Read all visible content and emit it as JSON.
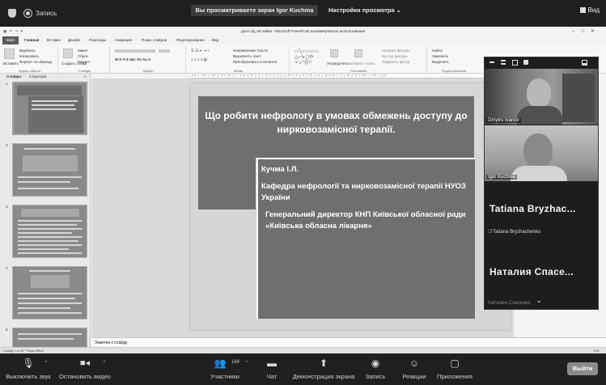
{
  "zoom_top": {
    "recording_label": "Запись",
    "share_banner": "Вы просматриваете экран Igor Kuchma",
    "view_options": "Настройки просмотра ⌄",
    "view_button": "Вид"
  },
  "ppt": {
    "window_title": "дало під час війни - Microsoft PowerPoint некоммерческое использование",
    "tabs": [
      "Файл",
      "Главная",
      "Вставка",
      "Дизайн",
      "Переходы",
      "Анимация",
      "Показ слайдов",
      "Рецензирование",
      "Вид"
    ],
    "ribbon": {
      "clipboard_label": "Буфер обмена",
      "paste": "Вставить",
      "cut": "Вырезать",
      "copy": "Копировать",
      "format_painter": "Формат по образцу",
      "slides_label": "Слайды",
      "new_slide": "Создать слайд",
      "layout": "Макет",
      "reset": "Сброс",
      "section": "Раздел",
      "font_label": "Шрифт",
      "paragraph_label": "Абзац",
      "text_direction": "Направление текста",
      "align_text": "Выровнять текст",
      "smartart": "Преобразовать в SmartArt",
      "drawing_label": "Рисование",
      "arrange": "Упорядочить",
      "quick_styles": "Экспресс-стили",
      "shape_fill": "Заливка фигуры",
      "shape_outline": "Контур фигуры",
      "shape_effects": "Эффекты фигур",
      "editing_label": "Редактирование",
      "find": "Найти",
      "replace": "Заменить",
      "select": "Выделить"
    },
    "pane_tabs": [
      "Слайды",
      "Структура"
    ],
    "thumb_numbers": [
      "1",
      "2",
      "3",
      "4",
      "5"
    ],
    "slide": {
      "title": "Що робити нефрологу в умовах обмежень доступу до нирковозамісної терапії.",
      "author": "Кучма І.Л.",
      "dept": "Кафедра нефрології та нирковозамісної терапії НУОЗ України",
      "position": "Генеральний директор КНП Київської обласної ради «Київська обласна лікарня»"
    },
    "notes_placeholder": "Заметки к слайду",
    "status_left": "Слайд 1 из 87   \"Тема Office\"",
    "status_right": "70%"
  },
  "video_panel": {
    "participants": [
      {
        "name": "Dmytro Ivanov",
        "type": "video"
      },
      {
        "name": "Igor Kuchma",
        "type": "video"
      },
      {
        "big_name": "Tatiana  Bryzhac...",
        "name": "Tatiana Bryzhachenko",
        "type": "name"
      },
      {
        "big_name": "Наталия  Спасе...",
        "name": "Наталия Спасенко",
        "type": "name"
      }
    ]
  },
  "zoom_bottom": {
    "mute": "Выключить звук",
    "stop_video": "Остановить видео",
    "participants": "Участники",
    "participants_count": "164",
    "chat": "Чат",
    "share_screen": "Демонстрация экрана",
    "record": "Запись",
    "reactions": "Реакции",
    "apps": "Приложения",
    "leave": "Выйти"
  }
}
